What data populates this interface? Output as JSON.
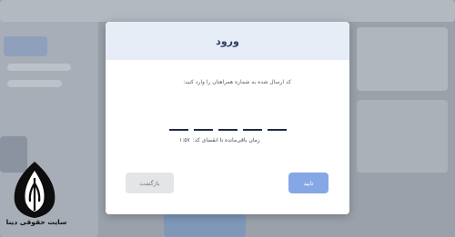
{
  "modal": {
    "title": "ورود",
    "instruction": "کد ارسال شده به شماره همراهتان را وارد کنید:",
    "otp_slots": [
      "",
      "",
      "",
      "",
      ""
    ],
    "timer_label": "زمان باقی‌مانده تا انقضای کد:",
    "timer_value": "۱:۵۷",
    "back_label": "بازگشت",
    "confirm_label": "تایید"
  },
  "watermark": {
    "site_name": "سایت حقوقی دینا"
  },
  "colors": {
    "header_bg": "#e7edf6",
    "title": "#2c3e66",
    "confirm_bg": "#86a7e6",
    "back_bg": "#e4e5e7"
  }
}
